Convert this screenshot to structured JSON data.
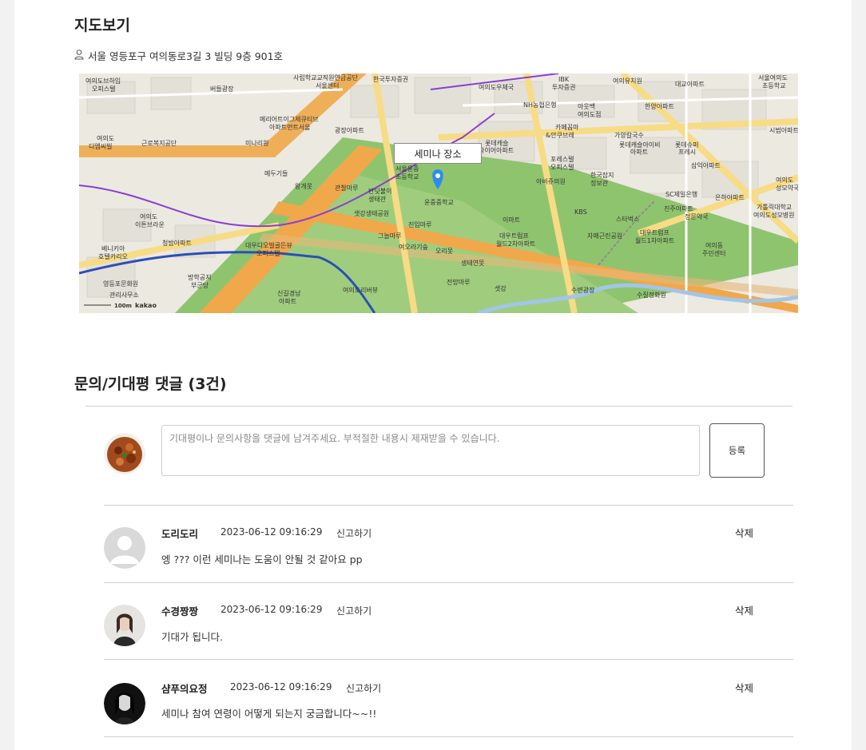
{
  "map_section": {
    "title": "지도보기",
    "address": "서울 영등포구 여의동로3길 3 빌딩 9층 901호",
    "marker_label": "세미나 장소",
    "map_labels": [
      "여의도브하임 오피스텔",
      "버들광장",
      "사립학교교직원연금공단",
      "서울센터",
      "한국투자증권",
      "여의도우체국",
      "IBK 투자증권",
      "여의유치원",
      "대교아파트",
      "서울여의도 초등학교",
      "NH농협은행",
      "아웃백 여의도점",
      "한양아파트",
      "메리어트이그제큐티브",
      "아파트먼트서울",
      "광장아파트",
      "카페꼼마&안쿠브레",
      "가양칼국수",
      "시범아파트",
      "근로복지공단",
      "미나리원",
      "롯데캐슬 파이어아파트",
      "롯데캐슬아이비 아파트",
      "롯데슈퍼 프레시",
      "여의도 디엠씨빌",
      "메두기들",
      "서울윤중 초등학교",
      "포레스텔 오피스텔",
      "삼익아파트",
      "왕개못",
      "관찰마루",
      "반딧불이 생태관",
      "아비쥬의원",
      "한국잡지 정보관",
      "SC제일은행",
      "은하아파트",
      "여의도 성모약국",
      "KBS",
      "윤중중학교",
      "샛강생태공원",
      "진입마루",
      "이마트",
      "가톨릭대학교 여의도성모병원",
      "여의도 이튼브라운",
      "진주아파트",
      "정문약국",
      "청밤아파트",
      "그늘마루",
      "여오라기숲",
      "오리못",
      "대우트럼프 월드2차아파트",
      "스타벅스",
      "자매근린공원",
      "대우트럼프 월드1차아파트",
      "여의동 주민센터",
      "베니키아 호텔카리오",
      "대우디오빌골든뷰 오피스텔",
      "생태연못",
      "방학공지 부군당",
      "영등포문화원",
      "관리사무소",
      "신길경남 아파트",
      "여의도리버뷰",
      "전망마루",
      "샛강",
      "수변광장",
      "수질정화원"
    ],
    "scale_label": "100m",
    "brand": "kakao"
  },
  "comments_section": {
    "title": "문의/기대평 댓글 (3건)",
    "input_placeholder": "기대평이나 문의사항을 댓글에 남겨주세요. 부적절한 내용시 제재받을 수 있습니다.",
    "register_label": "등록",
    "comments": [
      {
        "author": "도리도리",
        "date": "2023-06-12 09:16:29",
        "report": "신고하기",
        "delete": "삭제",
        "text": "엥 ??? 이런 세미나는 도움이 안될 것 같아요 pp",
        "avatar": "default-avatar"
      },
      {
        "author": "수경짱짱",
        "date": "2023-06-12 09:16:29",
        "report": "신고하기",
        "delete": "삭제",
        "text": "기대가 됩니다.",
        "avatar": "photo-avatar"
      },
      {
        "author": "샴푸의요정",
        "date": "2023-06-12 09:16:29",
        "report": "신고하기",
        "delete": "삭제",
        "text": "세미나 참여 연령이 어떻게 되는지 궁금합니다~~!!",
        "avatar": "photo-avatar"
      }
    ]
  },
  "colors": {
    "park_green": "#8fc46f",
    "highway_orange": "#f0a84a",
    "road_yellow": "#f7dc85",
    "river_blue": "#a3c5e6",
    "marker_blue": "#2d8cf0",
    "subway_purple": "#8a3fd1",
    "subway_blue": "#2a4fb8"
  }
}
